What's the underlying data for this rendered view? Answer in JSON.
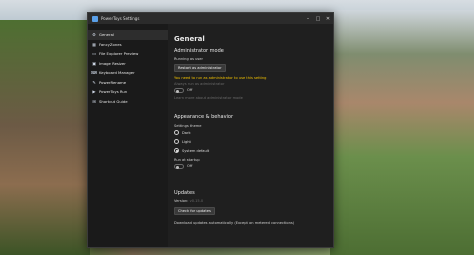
{
  "window": {
    "title": "PowerToys Settings",
    "minimize": "–",
    "maximize": "□",
    "close": "✕"
  },
  "sidebar": {
    "items": [
      {
        "label": "General",
        "icon": "gear-icon",
        "glyph": "⚙"
      },
      {
        "label": "FancyZones",
        "icon": "grid-icon",
        "glyph": "▦"
      },
      {
        "label": "File Explorer Preview",
        "icon": "folder-icon",
        "glyph": "▭"
      },
      {
        "label": "Image Resizer",
        "icon": "image-icon",
        "glyph": "▣"
      },
      {
        "label": "Keyboard Manager",
        "icon": "keyboard-icon",
        "glyph": "⌨"
      },
      {
        "label": "PowerRename",
        "icon": "rename-icon",
        "glyph": "✎"
      },
      {
        "label": "PowerToys Run",
        "icon": "run-icon",
        "glyph": "▶"
      },
      {
        "label": "Shortcut Guide",
        "icon": "shortcut-icon",
        "glyph": "⊞"
      }
    ]
  },
  "general": {
    "title": "General",
    "admin": {
      "heading": "Administrator mode",
      "running_as": "Running as user",
      "restart_button": "Restart as administrator",
      "warning": "You need to run as administrator to use this setting",
      "always_run_label": "Always run as administrator",
      "toggle_state": "Off",
      "learn_more": "Learn more about administrator mode"
    },
    "appearance": {
      "heading": "Appearance & behavior",
      "theme_label": "Settings theme",
      "themes": [
        "Dark",
        "Light",
        "System default"
      ],
      "selected_theme": "System default",
      "startup_label": "Run at startup",
      "startup_state": "Off"
    },
    "updates": {
      "heading": "Updates",
      "version_label": "Version:",
      "version_value": "v0.15.0",
      "check_button": "Check for updates",
      "auto_download_label": "Download updates automatically (Except on metered connections)"
    }
  }
}
